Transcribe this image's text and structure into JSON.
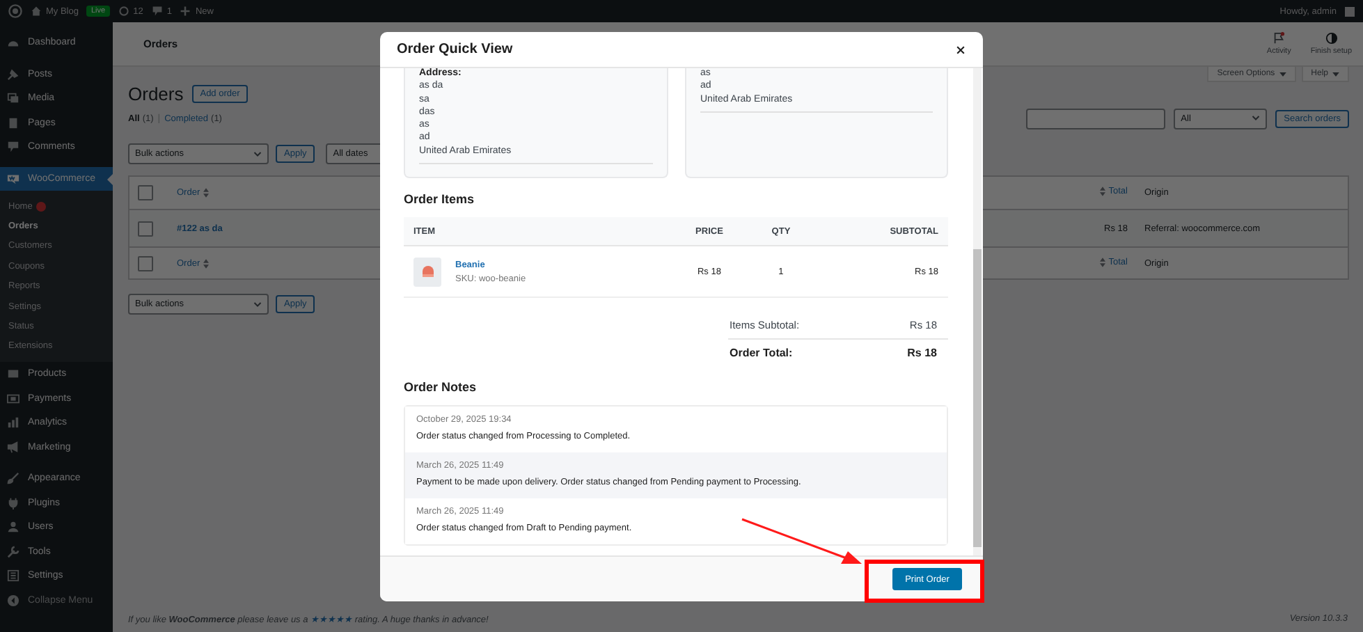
{
  "admin_bar": {
    "site": "My Blog",
    "badge": "Live",
    "updates": "12",
    "comments": "1",
    "new_label": "New",
    "greeting": "Howdy, admin"
  },
  "sidebar": {
    "groups": [
      [
        {
          "label": "Dashboard",
          "selected": false
        }
      ],
      [
        {
          "label": "Posts",
          "selected": false
        },
        {
          "label": "Media",
          "selected": false
        },
        {
          "label": "Pages",
          "selected": false
        },
        {
          "label": "Comments",
          "selected": false
        }
      ],
      [
        {
          "label": "WooCommerce",
          "selected": true,
          "children": [
            {
              "label": "Home",
              "alert": true,
              "selected": false
            },
            {
              "label": "Orders",
              "alert": false,
              "selected": true
            },
            {
              "label": "Customers",
              "alert": false,
              "selected": false
            },
            {
              "label": "Coupons",
              "alert": false,
              "selected": false
            },
            {
              "label": "Reports",
              "alert": false,
              "selected": false
            },
            {
              "label": "Settings",
              "alert": false,
              "selected": false
            },
            {
              "label": "Status",
              "alert": false,
              "selected": false
            },
            {
              "label": "Extensions",
              "alert": false,
              "selected": false
            }
          ]
        },
        {
          "label": "Products",
          "selected": false
        },
        {
          "label": "Payments",
          "selected": false
        },
        {
          "label": "Analytics",
          "selected": false
        },
        {
          "label": "Marketing",
          "selected": false
        }
      ],
      [
        {
          "label": "Appearance",
          "selected": false
        },
        {
          "label": "Plugins",
          "selected": false
        },
        {
          "label": "Users",
          "selected": false
        },
        {
          "label": "Tools",
          "selected": false
        },
        {
          "label": "Settings",
          "selected": false
        },
        {
          "label": "Collapse Menu",
          "selected": false
        }
      ]
    ]
  },
  "header": {
    "title": "Orders",
    "actions": [
      {
        "label": "Activity",
        "kind": "flag",
        "alert": true
      },
      {
        "label": "Finish setup",
        "kind": "contrast",
        "alert": false
      }
    ]
  },
  "screen_tabs": [
    "Screen Options",
    "Help"
  ],
  "page": {
    "heading": "Orders",
    "add_button": "Add order",
    "filters": [
      {
        "label": "All",
        "count": "(1)",
        "selected": true
      },
      {
        "label": "Completed",
        "count": "(1)",
        "selected": false
      }
    ],
    "filter_separator": "|",
    "status_filter": "All",
    "search_button": "Search orders",
    "bulk_actions": "Bulk actions",
    "apply": "Apply",
    "dates": "All dates"
  },
  "table": {
    "header": {
      "checked": false,
      "columns": [
        "Order",
        "Total",
        "Origin"
      ]
    },
    "rows": [
      {
        "checked": false,
        "order": "#122 as da",
        "total": "Rs 18",
        "origin": "Referral: woocommerce.com"
      }
    ],
    "footer": {
      "checked": false,
      "columns": [
        "Order",
        "Total",
        "Origin"
      ]
    }
  },
  "bottom_actions": {
    "bulk_actions": "Bulk actions",
    "apply": "Apply"
  },
  "footer": {
    "text": "If you like **WooCommerce** please leave us a",
    "rating_link": "★★★★★",
    "text_after": "rating. A huge thanks in advance!",
    "version": "Version 10.3.3"
  },
  "modal": {
    "title": "Order Quick View",
    "addresses": [
      {
        "label": "Address:",
        "lines": [
          "as da",
          "sa",
          "das",
          "as",
          "ad",
          "United Arab Emirates"
        ]
      },
      {
        "lines": [
          "as",
          "ad",
          "United Arab Emirates"
        ]
      }
    ],
    "items_heading": "Order Items",
    "item_columns": [
      "ITEM",
      "PRICE",
      "QTY",
      "SUBTOTAL"
    ],
    "items": [
      {
        "name": "Beanie",
        "sku": "SKU: woo-beanie",
        "price": "Rs 18",
        "qty": "1",
        "subtotal": "Rs 18"
      }
    ],
    "totals": [
      {
        "label": "Items Subtotal:",
        "value": "Rs 18",
        "kind": "subtotal"
      },
      {
        "label": "Order Total:",
        "value": "Rs 18",
        "kind": "total"
      }
    ],
    "notes_heading": "Order Notes",
    "notes": [
      {
        "date": "October 29, 2025 19:34",
        "text": "Order status changed from Processing to Completed."
      },
      {
        "date": "March 26, 2025 11:49",
        "text": "Payment to be made upon delivery. Order status changed from Pending payment to Processing."
      },
      {
        "date": "March 26, 2025 11:49",
        "text": "Order status changed from Draft to Pending payment."
      }
    ],
    "print_button": "Print Order"
  }
}
